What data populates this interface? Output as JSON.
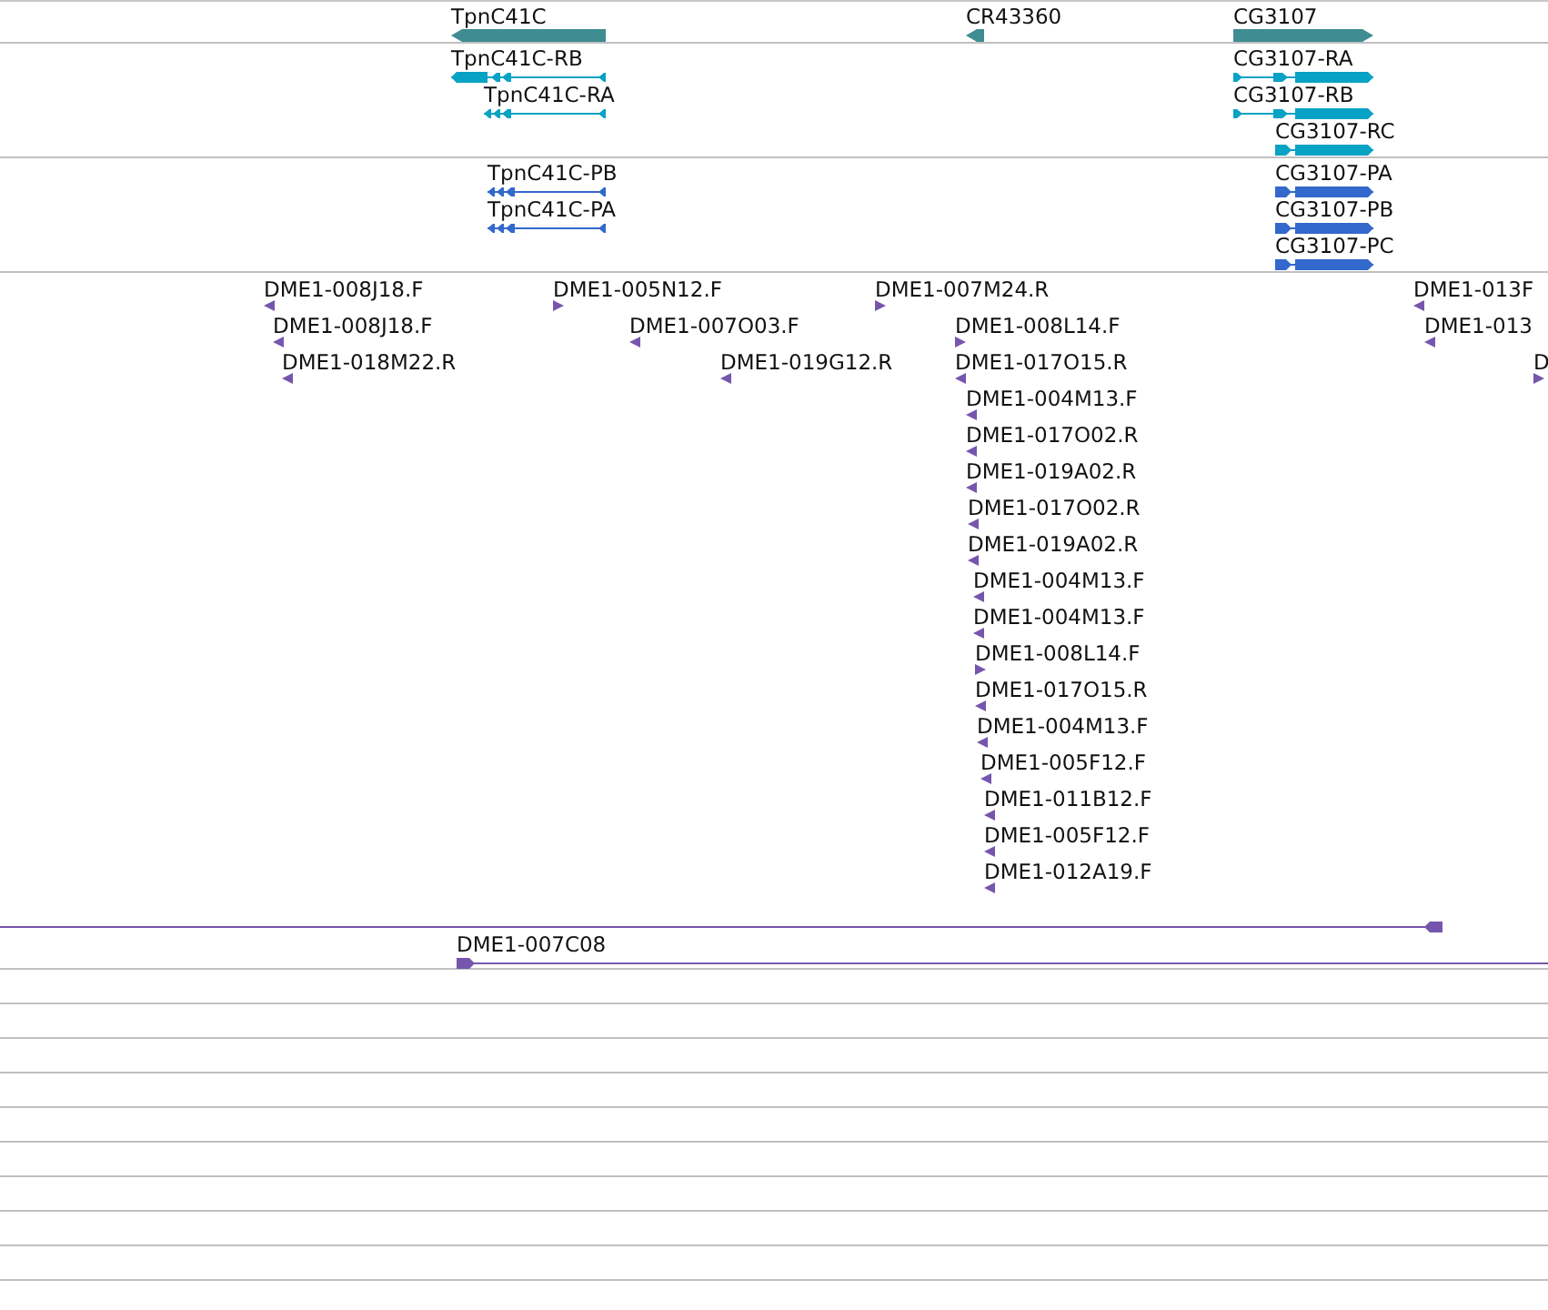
{
  "tracks": [
    {
      "kind": "gene",
      "features": [
        {
          "label": "TpnC41C",
          "reverse": true
        },
        {
          "label": "CR43360",
          "reverse": true
        },
        {
          "label": "CG3107",
          "reverse": false
        }
      ]
    },
    {
      "kind": "transcript",
      "features": [
        {
          "label": "TpnC41C-RB",
          "reverse": true
        },
        {
          "label": "TpnC41C-RA",
          "reverse": true
        },
        {
          "label": "CG3107-RA",
          "reverse": false
        },
        {
          "label": "CG3107-RB",
          "reverse": false
        },
        {
          "label": "CG3107-RC",
          "reverse": false
        }
      ]
    },
    {
      "kind": "protein",
      "features": [
        {
          "label": "TpnC41C-PB",
          "reverse": true
        },
        {
          "label": "TpnC41C-PA",
          "reverse": true
        },
        {
          "label": "CG3107-PA",
          "reverse": false
        },
        {
          "label": "CG3107-PB",
          "reverse": false
        },
        {
          "label": "CG3107-PC",
          "reverse": false
        }
      ]
    },
    {
      "kind": "est",
      "features": [
        {
          "label": "DME1-008J18.F",
          "reverse": true
        },
        {
          "label": "DME1-008J18.F",
          "reverse": true
        },
        {
          "label": "DME1-018M22.R",
          "reverse": true
        },
        {
          "label": "DME1-005N12.F",
          "reverse": false
        },
        {
          "label": "DME1-007O03.F",
          "reverse": true
        },
        {
          "label": "DME1-019G12.R",
          "reverse": true
        },
        {
          "label": "DME1-007M24.R",
          "reverse": false
        },
        {
          "label": "DME1-008L14.F",
          "reverse": false
        },
        {
          "label": "DME1-017O15.R",
          "reverse": true
        },
        {
          "label": "DME1-004M13.F",
          "reverse": true
        },
        {
          "label": "DME1-017O02.R",
          "reverse": true
        },
        {
          "label": "DME1-019A02.R",
          "reverse": true
        },
        {
          "label": "DME1-017O02.R",
          "reverse": true
        },
        {
          "label": "DME1-019A02.R",
          "reverse": true
        },
        {
          "label": "DME1-004M13.F",
          "reverse": true
        },
        {
          "label": "DME1-004M13.F",
          "reverse": true
        },
        {
          "label": "DME1-008L14.F",
          "reverse": false
        },
        {
          "label": "DME1-017O15.R",
          "reverse": true
        },
        {
          "label": "DME1-004M13.F",
          "reverse": true
        },
        {
          "label": "DME1-005F12.F",
          "reverse": true
        },
        {
          "label": "DME1-011B12.F",
          "reverse": true
        },
        {
          "label": "DME1-005F12.F",
          "reverse": true
        },
        {
          "label": "DME1-012A19.F",
          "reverse": true
        },
        {
          "label": "DME1-013F",
          "reverse": true
        },
        {
          "label": "DME1-013",
          "reverse": true
        },
        {
          "label": "D",
          "reverse": false
        }
      ],
      "spans": [
        {
          "reverse": true
        },
        {
          "label": "DME1-007C08",
          "reverse": false
        }
      ]
    }
  ]
}
